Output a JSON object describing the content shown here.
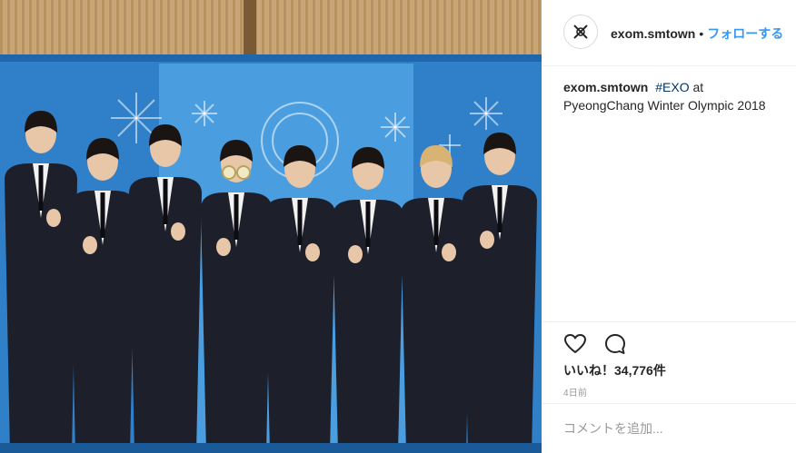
{
  "post": {
    "username": "exom.smtown",
    "separator": "•",
    "follow_label": "フォローする",
    "caption_hashtag": "#EXO",
    "caption_text": " at PyeongChang Winter Olympic 2018",
    "likes_label": "いいね！",
    "likes_count": "34,776件",
    "time_ago": "4日前",
    "comment_placeholder": "コメントを追加..."
  },
  "photo": {
    "wall_color": "#c9a779",
    "backdrop_color": "#2f7fc9",
    "suit_color": "#1d1f2b",
    "description_people": 8
  },
  "icons": {
    "avatar": "exo-logo-icon",
    "like": "heart-icon",
    "comment": "comment-bubble-icon"
  }
}
